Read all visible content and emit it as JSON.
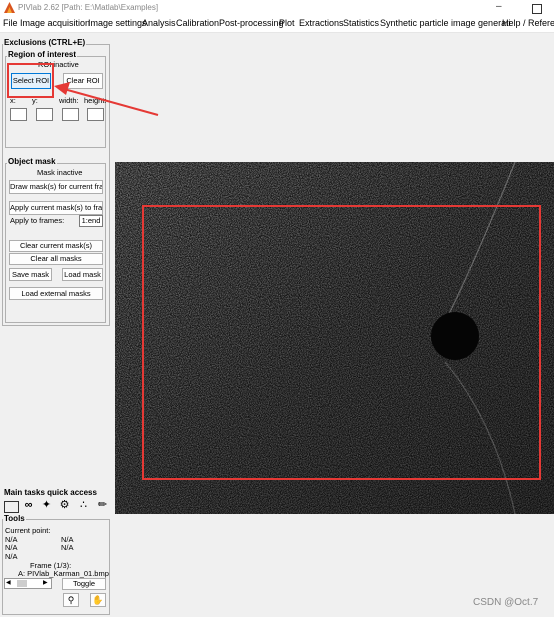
{
  "window": {
    "title": "PIVlab 2.62   [Path: E:\\Matlab\\Examples]"
  },
  "menu": [
    "File",
    "Image acquisition",
    "Image settings",
    "Analysis",
    "Calibration",
    "Post-processing",
    "Plot",
    "Extractions",
    "Statistics",
    "Synthetic particle image generati",
    "Help / Refere"
  ],
  "exclusions": {
    "title": "Exclusions (CTRL+E)",
    "roi": {
      "title": "Region of interest",
      "status": "ROI inactive",
      "select": "Select ROI",
      "clear": "Clear ROI",
      "x": "x:",
      "y": "y:",
      "width": "width:",
      "height": "height:"
    },
    "mask": {
      "title": "Object mask",
      "status": "Mask inactive",
      "draw": "Draw mask(s) for current fra...",
      "apply": "Apply current mask(s) to fra...",
      "apply_to": "Apply to frames:",
      "frames": "1:end",
      "clear_current": "Clear current mask(s)",
      "clear_all": "Clear all masks",
      "save": "Save mask",
      "load": "Load mask",
      "load_external": "Load external masks"
    }
  },
  "quick_access": {
    "title": "Main tasks quick access"
  },
  "tools": {
    "title": "Tools",
    "current_point": "Current point:",
    "values": [
      "N/A",
      "N/A",
      "N/A",
      "N/A",
      "N/A"
    ],
    "frame": "Frame (1/3):",
    "file": "A: PIVlab_Karman_01.bmp",
    "toggle": "Toggle"
  },
  "watermark": "CSDN @Oct.7",
  "colors": {
    "annotation": "#e53935",
    "image_bg": "#1a1a1a"
  }
}
